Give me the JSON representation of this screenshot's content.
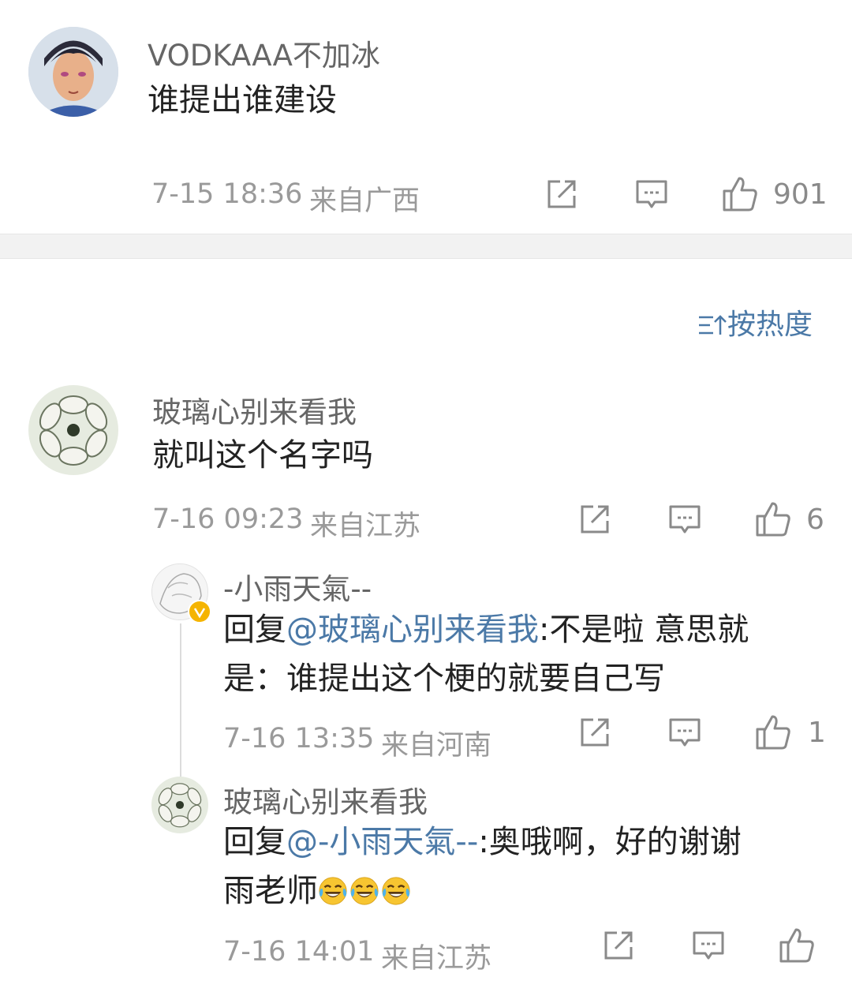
{
  "top_comment": {
    "username": "VODKAAA不加冰",
    "text": "谁提出谁建设",
    "date": "7-15 18:36",
    "location": "来自广西",
    "likes": "901",
    "avatar_icon": "anime-avatar-icon"
  },
  "sort_label": "按热度",
  "comments": [
    {
      "username": "玻璃心别来看我",
      "text": "就叫这个名字吗",
      "date": "7-16 09:23",
      "location": "来自江苏",
      "likes": "6"
    }
  ],
  "replies": [
    {
      "username": "-小雨天氣--",
      "reply_prefix": "回复",
      "mention": "@玻璃心别来看我",
      "text_line1": ":不是啦 意思就",
      "text_line2": "是：谁提出这个梗的就要自己写",
      "date": "7-16 13:35",
      "location": "来自河南",
      "likes": "1",
      "verified": true
    },
    {
      "username": "玻璃心别来看我",
      "reply_prefix": "回复",
      "mention": "@-小雨天氣--",
      "text_line1": ":奥哦啊，好的谢谢",
      "text_line2": "雨老师",
      "emoji": "laughing-crying-emoji",
      "date": "7-16 14:01",
      "location": "来自江苏",
      "likes": ""
    }
  ],
  "colors": {
    "mention": "#4b79a7",
    "meta": "#9a9a9a",
    "separator": "#f2f2f2"
  }
}
